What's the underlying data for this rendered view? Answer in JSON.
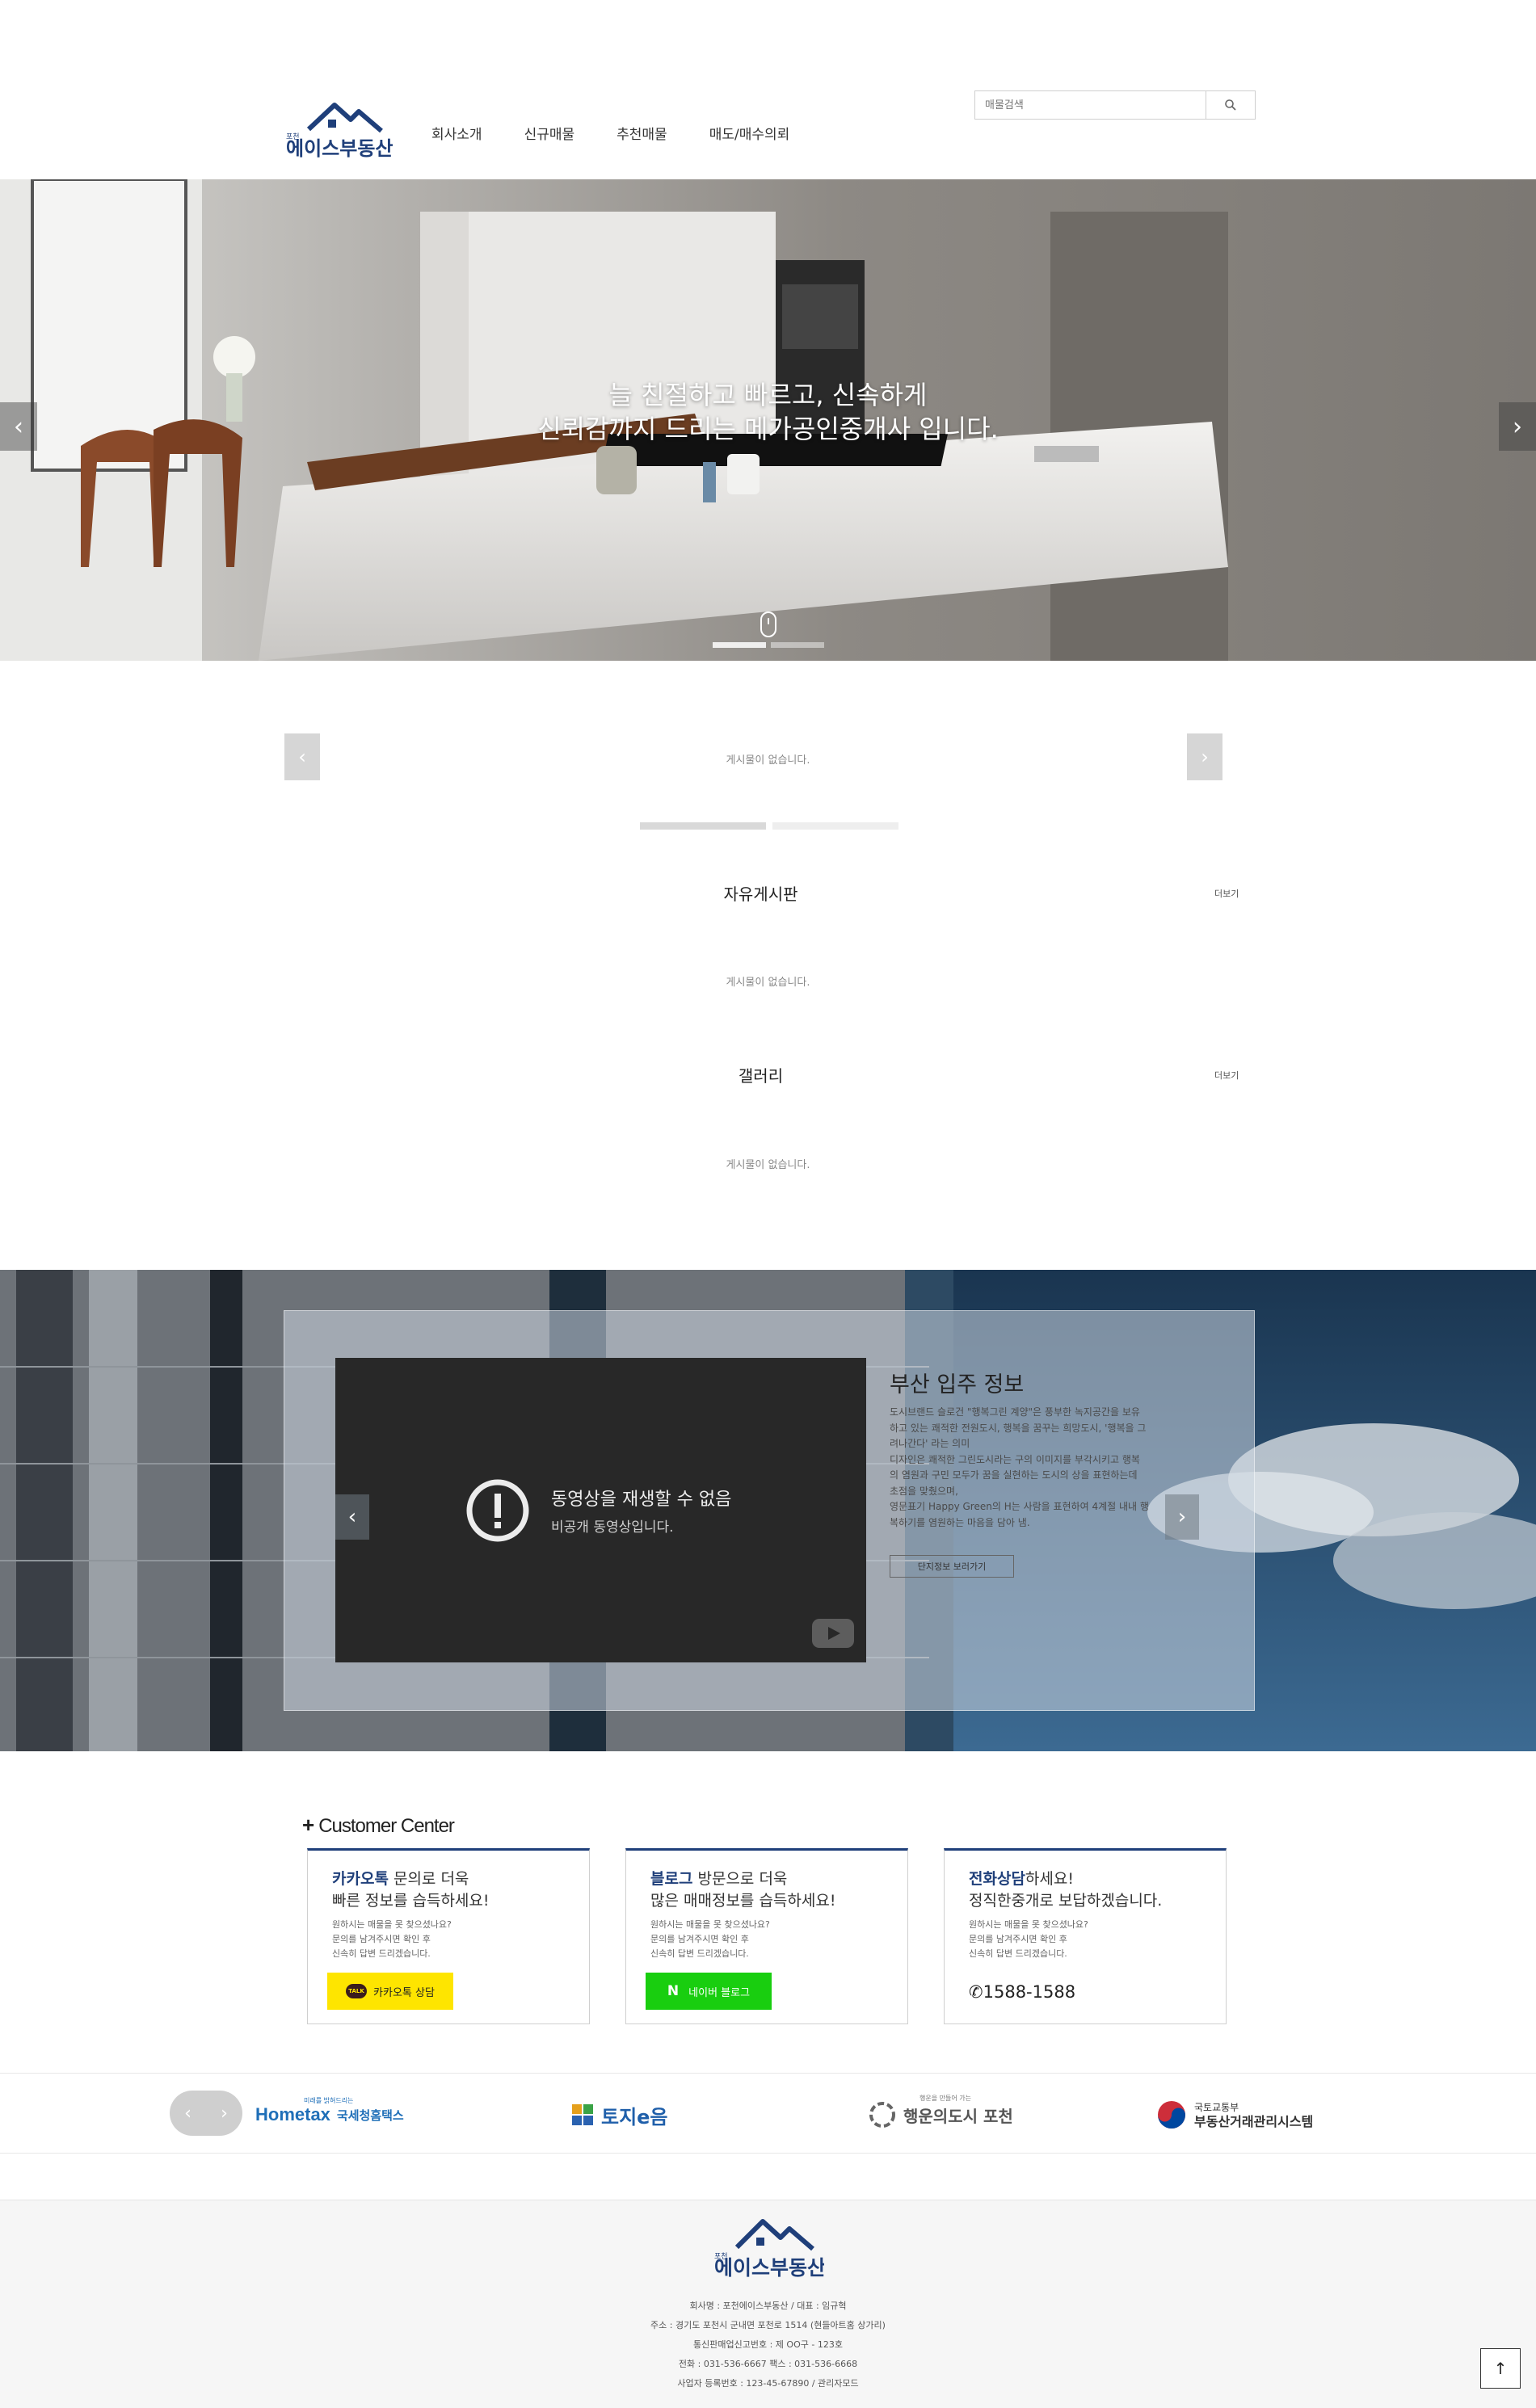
{
  "header": {
    "logo_small": "포천",
    "logo_text": "에이스부동산",
    "nav": [
      "회사소개",
      "신규매물",
      "추천매물",
      "매도/매수의뢰"
    ],
    "search_placeholder": "매물검색"
  },
  "hero": {
    "line1": "늘 친절하고 빠르고, 신속하게",
    "line2": "신뢰감까지 드리는 메가공인중개사 입니다.",
    "slides_total": 2,
    "active_slide": 1
  },
  "ticker": {
    "empty": "게시물이 없습니다."
  },
  "boards": [
    {
      "title": "자유게시판",
      "more": "더보기",
      "empty": "게시물이 없습니다."
    },
    {
      "title": "갤러리",
      "more": "더보기",
      "empty": "게시물이 없습니다."
    }
  ],
  "video_section": {
    "video_error_title": "동영상을 재생할 수 없음",
    "video_error_sub": "비공개 동영상입니다.",
    "info_title": "부산 입주 정보",
    "info_lines": [
      "도시브랜드 슬로건 \"행복그린 계양\"은 풍부한 녹지공간을 보유",
      "하고 있는 쾌적한 전원도시, 행복을 꿈꾸는 희망도시, '행복을 그",
      "려나간다' 라는 의미",
      "디자인은 쾌적한 그린도시라는 구의 이미지를 부각시키고 행복",
      "의 염원과 구민 모두가 꿈을 실현하는 도시의 상을 표현하는데",
      "초점을 맞췄으며,",
      "영문표기 Happy Green의 H는 사람을 표현하여 4계절 내내 행",
      "복하기를 염원하는 마음을 담아 냄."
    ],
    "info_button": "단지정보 보러가기"
  },
  "customer_center": {
    "title": "Customer Center",
    "cards": [
      {
        "highlight": "카카오톡",
        "rest": " 문의로 더욱",
        "line2": "빠른 정보를 습득하세요!",
        "desc": [
          "원하시는 매물을 못 찾으셨나요?",
          "문의를 남겨주시면 확인 후",
          "신속히 답변 드리겠습니다."
        ],
        "button": "카카오톡 상담",
        "button_icon": "TALK"
      },
      {
        "highlight": "블로그",
        "rest": " 방문으로 더욱",
        "line2": "많은 매매정보를 습득하세요!",
        "desc": [
          "원하시는 매물을 못 찾으셨나요?",
          "문의를 남겨주시면 확인 후",
          "신속히 답변 드리겠습니다."
        ],
        "button": "네이버 블로그",
        "button_icon": "N"
      },
      {
        "highlight": "전화상담",
        "rest": "하세요!",
        "line2": "정직한중개로 보답하겠습니다.",
        "desc": [
          "원하시는 매물을 못 찾으셨나요?",
          "문의를 남겨주시면 확인 후",
          "신속히 답변 드리겠습니다."
        ],
        "phone": "1588-1588"
      }
    ]
  },
  "partners": [
    {
      "name": "Hometax",
      "sub": "국세청홈택스",
      "tagline": "미래를 밝혀드리는"
    },
    {
      "name": "토지e음"
    },
    {
      "name": "행운의도시 포천",
      "tagline": "행운을 만들어 가는"
    },
    {
      "name": "국토교통부",
      "sub": "부동산거래관리시스템"
    }
  ],
  "footer": {
    "lines": [
      "회사명 : 포천에이스부동산 / 대표 : 임규혁",
      "주소 : 경기도 포천시 군내면 포천로 1514 (현들아트홈 상가리)",
      "통신판매업신고번호 : 제 OO구 - 123호",
      "전화 : 031-536-6667 팩스 : 031-536-6668",
      "사업자 등록번호 : 123-45-67890 / 관리자모드"
    ]
  },
  "colors": {
    "brand": "#1f3f7a",
    "kakao": "#fee500",
    "naver": "#19ce0f"
  }
}
